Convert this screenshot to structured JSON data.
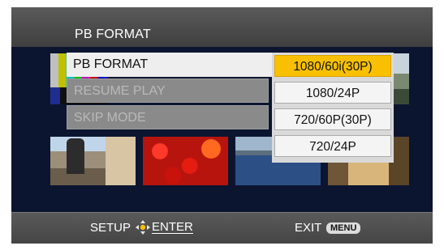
{
  "header": {
    "title": "PB FORMAT"
  },
  "menu": {
    "items": [
      {
        "label": "PB FORMAT",
        "state": "active"
      },
      {
        "label": "RESUME PLAY",
        "state": "disabled"
      },
      {
        "label": "SKIP MODE",
        "state": "disabled"
      }
    ]
  },
  "options": {
    "items": [
      {
        "label": "1080/60i(30P)",
        "selected": true
      },
      {
        "label": "1080/24P",
        "selected": false
      },
      {
        "label": "720/60P(30P)",
        "selected": false
      },
      {
        "label": "720/24P",
        "selected": false
      }
    ]
  },
  "footer": {
    "setup_label": "SETUP",
    "enter_label": "ENTER",
    "exit_label": "EXIT",
    "menu_badge": "MENU"
  },
  "colors": {
    "selected_option": "#f8c000",
    "bar_background": "#4e4e4e"
  },
  "icons": {
    "enter": "dpad-icon"
  }
}
